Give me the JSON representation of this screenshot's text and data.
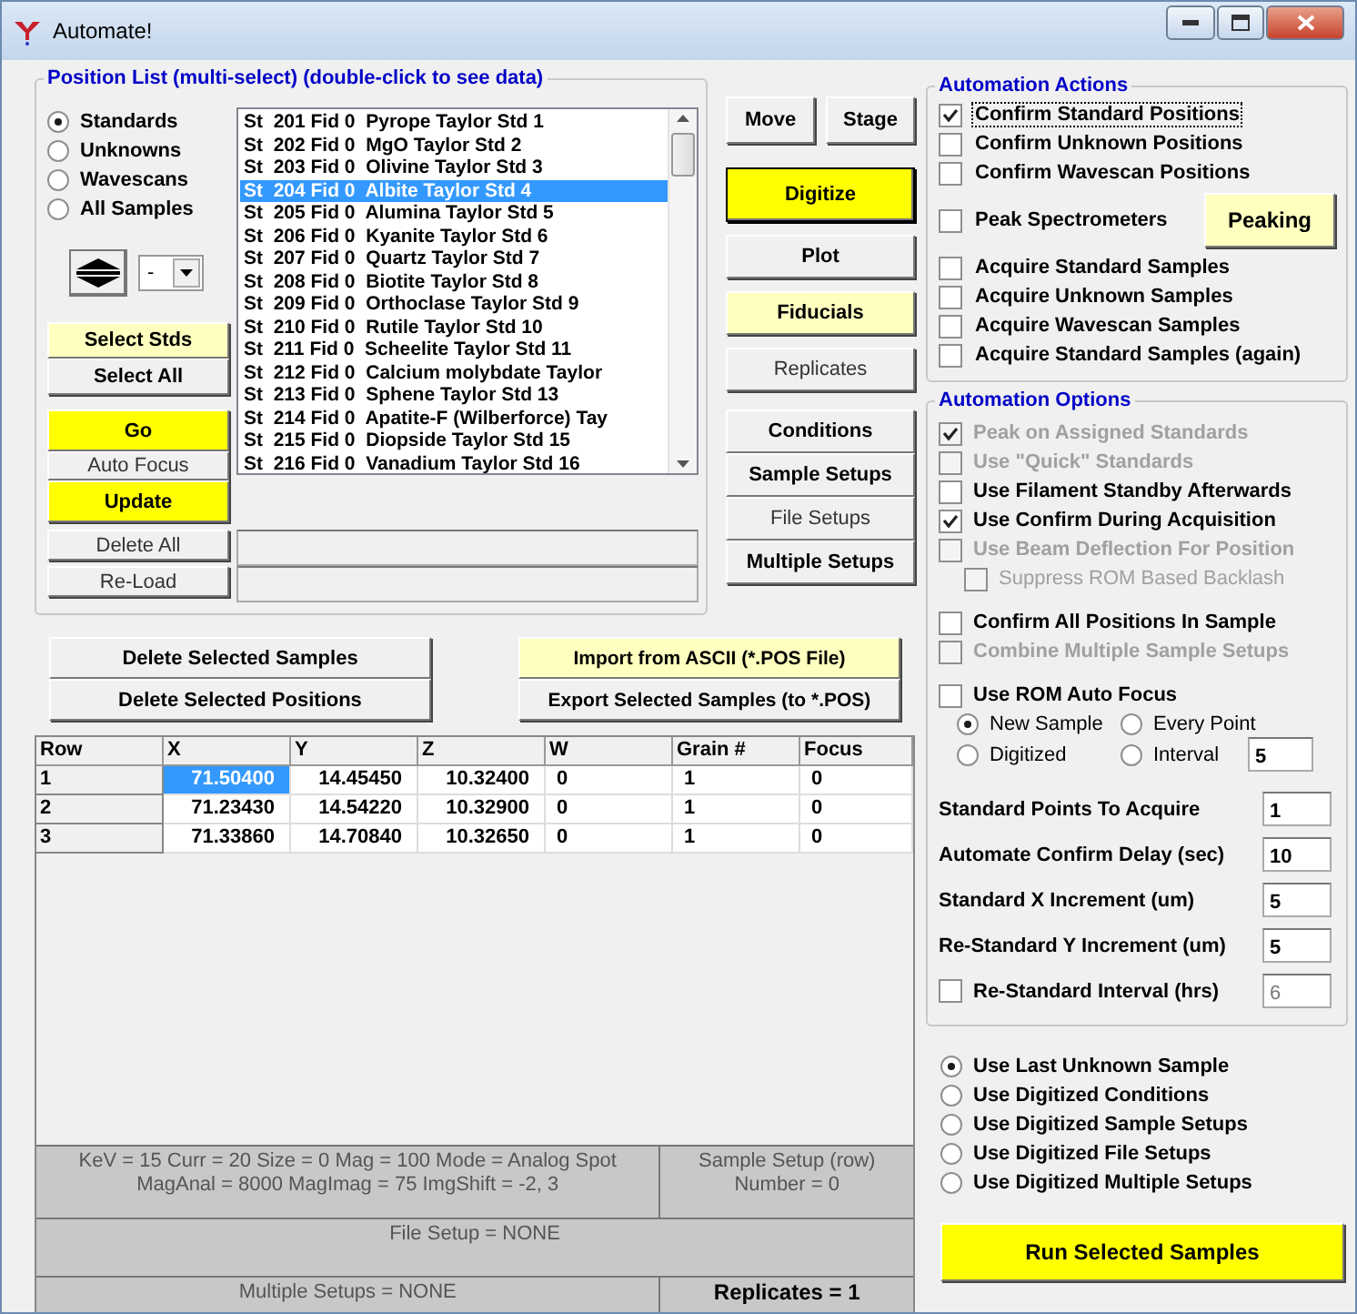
{
  "window": {
    "title": "Automate!"
  },
  "position_list": {
    "title": "Position List (multi-select) (double-click to see data)",
    "filters": [
      {
        "label": "Standards",
        "selected": true
      },
      {
        "label": "Unknowns",
        "selected": false
      },
      {
        "label": "Wavescans",
        "selected": false
      },
      {
        "label": "All Samples",
        "selected": false
      }
    ],
    "sort_value": "-",
    "buttons": [
      {
        "label": "Select Stds",
        "kind": "pale"
      },
      {
        "label": "Select All",
        "kind": "bold"
      },
      {
        "label": "Go",
        "kind": "yellow"
      },
      {
        "label": "Auto Focus",
        "kind": "light"
      },
      {
        "label": "Update",
        "kind": "yellow"
      }
    ],
    "items": [
      {
        "text": "St  201 Fid 0  Pyrope Taylor Std 1",
        "selected": false
      },
      {
        "text": "St  202 Fid 0  MgO Taylor Std 2",
        "selected": false
      },
      {
        "text": "St  203 Fid 0  Olivine Taylor Std 3",
        "selected": false
      },
      {
        "text": "St  204 Fid 0  Albite Taylor Std 4",
        "selected": true
      },
      {
        "text": "St  205 Fid 0  Alumina Taylor Std 5",
        "selected": false
      },
      {
        "text": "St  206 Fid 0  Kyanite Taylor Std 6",
        "selected": false
      },
      {
        "text": "St  207 Fid 0  Quartz Taylor Std 7",
        "selected": false
      },
      {
        "text": "St  208 Fid 0  Biotite Taylor Std 8",
        "selected": false
      },
      {
        "text": "St  209 Fid 0  Orthoclase Taylor Std 9",
        "selected": false
      },
      {
        "text": "St  210 Fid 0  Rutile Taylor Std 10",
        "selected": false
      },
      {
        "text": "St  211 Fid 0  Scheelite Taylor Std 11",
        "selected": false
      },
      {
        "text": "St  212 Fid 0  Calcium molybdate Taylor",
        "selected": false
      },
      {
        "text": "St  213 Fid 0  Sphene Taylor Std 13",
        "selected": false
      },
      {
        "text": "St  214 Fid 0  Apatite-F (Wilberforce) Tay",
        "selected": false
      },
      {
        "text": "St  215 Fid 0  Diopside Taylor Std 15",
        "selected": false
      },
      {
        "text": "St  216 Fid 0  Vanadium Taylor Std 16",
        "selected": false
      }
    ],
    "bottom_buttons": [
      {
        "label": "Delete All",
        "kind": "light"
      },
      {
        "label": "Re-Load",
        "kind": "light"
      }
    ]
  },
  "stage_buttons": [
    {
      "label": "Move",
      "kind": "bold"
    },
    {
      "label": "Stage",
      "kind": "bold"
    }
  ],
  "tool_buttons": [
    {
      "label": "Digitize",
      "kind": "yellow",
      "default": true
    },
    {
      "label": "Plot",
      "kind": "bold"
    },
    {
      "label": "Fiducials",
      "kind": "pale"
    },
    {
      "label": "Replicates",
      "kind": "light"
    }
  ],
  "setup_buttons": [
    {
      "label": "Conditions",
      "kind": "bold"
    },
    {
      "label": "Sample Setups",
      "kind": "bold"
    },
    {
      "label": "File Setups",
      "kind": "light"
    },
    {
      "label": "Multiple Setups",
      "kind": "bold"
    }
  ],
  "delete_buttons": [
    {
      "label": "Delete Selected Samples",
      "kind": "bold"
    },
    {
      "label": "Delete Selected Positions",
      "kind": "bold"
    }
  ],
  "file_buttons": [
    {
      "label": "Import from ASCII (*.POS File)",
      "kind": "pale"
    },
    {
      "label": "Export Selected Samples (to *.POS)",
      "kind": "bold"
    }
  ],
  "table": {
    "columns": [
      "Row",
      "X",
      "Y",
      "Z",
      "W",
      "Grain #",
      "Focus"
    ],
    "rows": [
      {
        "cells": [
          {
            "text": "1",
            "selected": false
          },
          {
            "text": "71.50400",
            "selected": true
          },
          {
            "text": "14.45450",
            "selected": false
          },
          {
            "text": "10.32400",
            "selected": false
          },
          {
            "text": "0",
            "selected": false
          },
          {
            "text": "1",
            "selected": false
          },
          {
            "text": "0",
            "selected": false
          }
        ]
      },
      {
        "cells": [
          {
            "text": "2",
            "selected": false
          },
          {
            "text": "71.23430",
            "selected": false
          },
          {
            "text": "14.54220",
            "selected": false
          },
          {
            "text": "10.32900",
            "selected": false
          },
          {
            "text": "0",
            "selected": false
          },
          {
            "text": "1",
            "selected": false
          },
          {
            "text": "0",
            "selected": false
          }
        ]
      },
      {
        "cells": [
          {
            "text": "3",
            "selected": false
          },
          {
            "text": "71.33860",
            "selected": false
          },
          {
            "text": "14.70840",
            "selected": false
          },
          {
            "text": "10.32650",
            "selected": false
          },
          {
            "text": "0",
            "selected": false
          },
          {
            "text": "1",
            "selected": false
          },
          {
            "text": "0",
            "selected": false
          }
        ]
      }
    ]
  },
  "info": {
    "conditions": "KeV = 15   Curr = 20   Size = 0   Mag = 100   Mode = Analog  Spot MagAnal = 8000   MagImag = 75   ImgShift = -2, 3",
    "sample_setup": "Sample Setup (row) Number = 0",
    "file_setup": "File Setup = NONE",
    "multiple_setups": "Multiple Setups = NONE",
    "replicates": "Replicates =  1"
  },
  "automation_actions": {
    "title": "Automation Actions",
    "items": [
      {
        "label": "Confirm Standard Positions",
        "checked": true,
        "focused": true
      },
      {
        "label": "Confirm Unknown Positions",
        "checked": false
      },
      {
        "label": "Confirm Wavescan Positions",
        "checked": false
      },
      {
        "label": "Peak Spectrometers",
        "checked": false,
        "button": "Peaking"
      },
      {
        "label": "Acquire Standard Samples",
        "checked": false
      },
      {
        "label": "Acquire Unknown Samples",
        "checked": false
      },
      {
        "label": "Acquire Wavescan Samples",
        "checked": false
      },
      {
        "label": "Acquire Standard Samples (again)",
        "checked": false
      }
    ]
  },
  "automation_options": {
    "title": "Automation Options",
    "groups": [
      [
        {
          "kind": "check",
          "label": "Peak on Assigned Standards",
          "checked": true,
          "disabled": true
        },
        {
          "kind": "check",
          "label": "Use \"Quick\" Standards",
          "checked": false,
          "disabled": true
        },
        {
          "kind": "check",
          "label": "Use Filament Standby Afterwards",
          "checked": false,
          "disabled": false
        },
        {
          "kind": "check",
          "label": "Use Confirm During Acquisition",
          "checked": true,
          "disabled": false
        },
        {
          "kind": "check",
          "label": "Use Beam Deflection For Position",
          "checked": false,
          "disabled": true
        },
        {
          "kind": "subcheck",
          "label": "Suppress ROM Based Backlash",
          "checked": false,
          "disabled": true
        }
      ],
      [
        {
          "kind": "check",
          "label": "Confirm All Positions In Sample",
          "checked": false,
          "disabled": false
        },
        {
          "kind": "check",
          "label": "Combine Multiple Sample Setups",
          "checked": false,
          "disabled": true
        }
      ],
      [
        {
          "kind": "check",
          "label": "Use ROM Auto Focus",
          "checked": false,
          "disabled": false
        },
        {
          "kind": "radios",
          "options": [
            {
              "label": "New Sample",
              "selected": true
            },
            {
              "label": "Every Point",
              "selected": false
            },
            {
              "label": "Digitized",
              "selected": false
            },
            {
              "label": "Interval",
              "selected": false
            }
          ],
          "value": "5"
        }
      ],
      [
        {
          "kind": "field",
          "label": "Standard Points To Acquire",
          "value": "1"
        },
        {
          "kind": "field",
          "label": "Automate Confirm Delay (sec)",
          "value": "10"
        },
        {
          "kind": "field",
          "label": "Standard X Increment (um)",
          "value": "5"
        },
        {
          "kind": "field",
          "label": "Re-Standard Y Increment (um)",
          "value": "5"
        },
        {
          "kind": "checkfield",
          "label": "Re-Standard Interval (hrs)",
          "checked": false,
          "value": "6",
          "disabled": true
        }
      ]
    ]
  },
  "run_modes": [
    {
      "label": "Use Last Unknown Sample",
      "selected": true
    },
    {
      "label": "Use Digitized Conditions",
      "selected": false
    },
    {
      "label": "Use Digitized Sample Setups",
      "selected": false
    },
    {
      "label": "Use Digitized File Setups",
      "selected": false
    },
    {
      "label": "Use Digitized Multiple Setups",
      "selected": false
    }
  ],
  "run_button": {
    "label": "Run Selected Samples",
    "kind": "yellow"
  }
}
